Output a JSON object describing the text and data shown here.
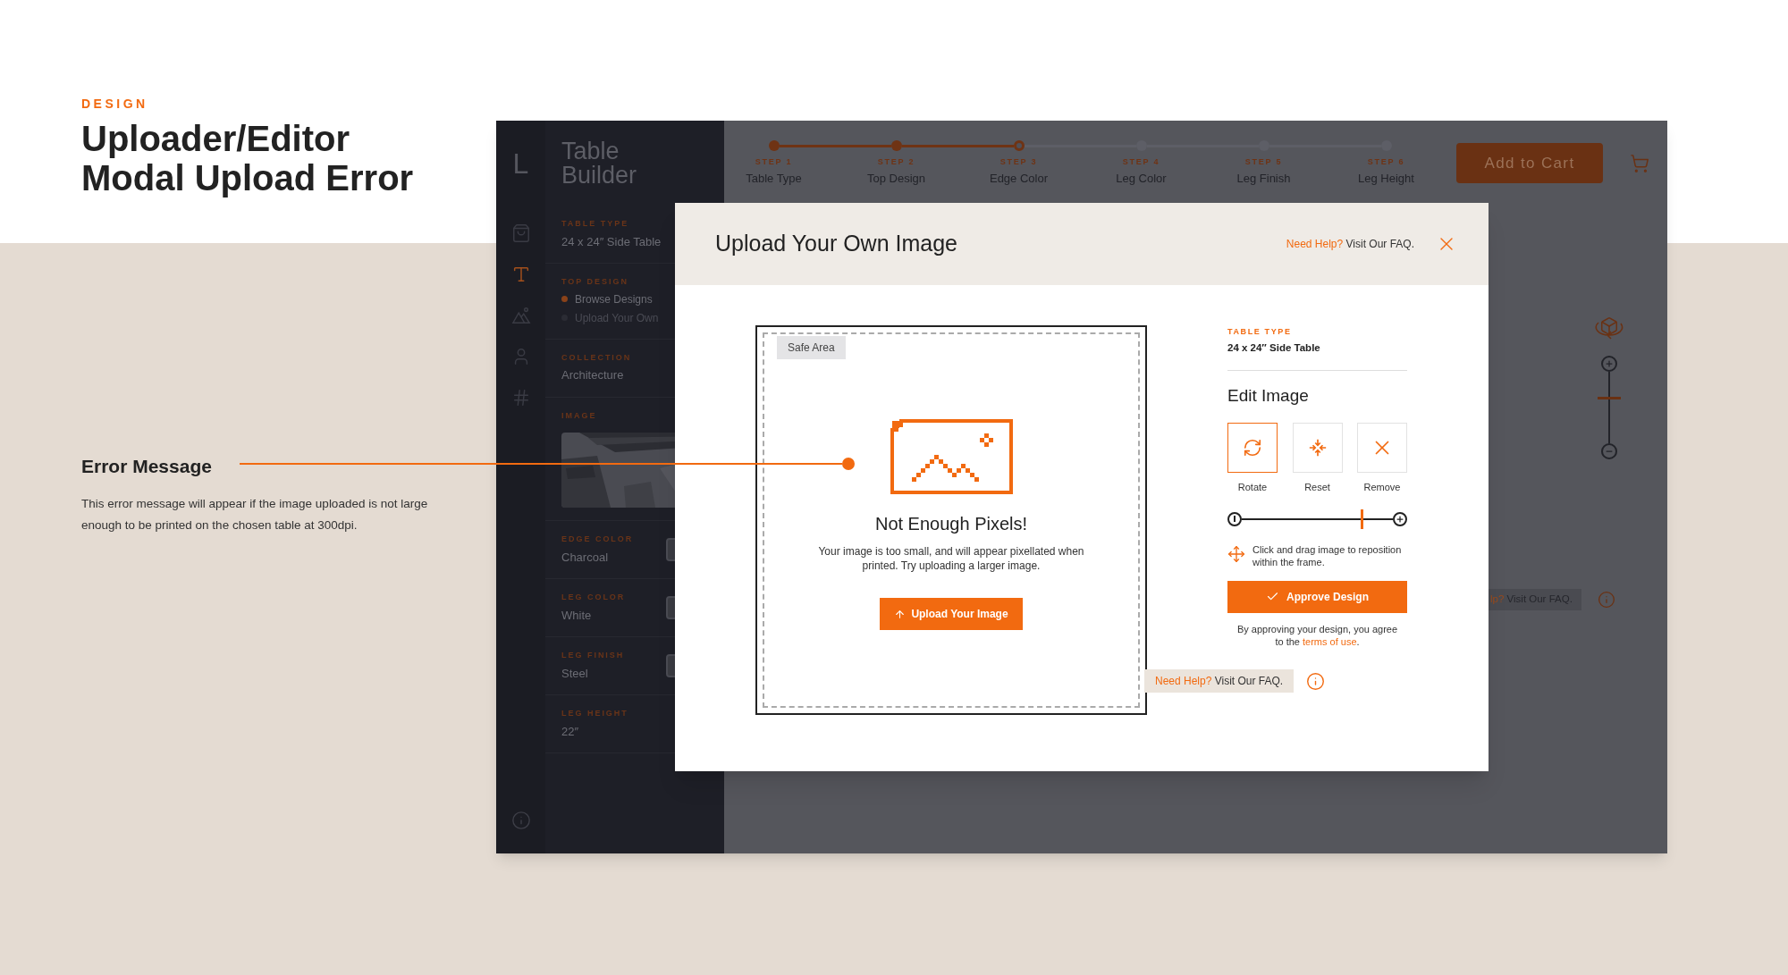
{
  "slide": {
    "eyebrow": "DESIGN",
    "title_lines": [
      "Uploader/Editor",
      "Modal Upload Error"
    ]
  },
  "annotation": {
    "title": "Error Message",
    "body": "This error message will appear if the image uploaded is not large enough to be printed on the chosen table at 300dpi."
  },
  "app": {
    "logo": "L",
    "brand_lines": [
      "Table",
      "Builder"
    ],
    "nav_icons": [
      {
        "kind": "bag",
        "selected": false
      },
      {
        "kind": "type",
        "selected": true
      },
      {
        "kind": "mountains",
        "selected": false
      },
      {
        "kind": "person",
        "selected": false
      },
      {
        "kind": "hash",
        "selected": false
      }
    ],
    "sections": [
      {
        "kind": "value",
        "label": "TABLE TYPE",
        "value": "24 x 24″ Side Table"
      },
      {
        "kind": "radio",
        "label": "TOP DESIGN",
        "options": [
          {
            "label": "Browse Designs",
            "selected": true
          },
          {
            "label": "Upload Your Own",
            "selected": false
          }
        ]
      },
      {
        "kind": "value",
        "label": "COLLECTION",
        "value": "Architecture"
      },
      {
        "kind": "picture",
        "label": "IMAGE"
      },
      {
        "kind": "swatch",
        "label": "EDGE COLOR",
        "value": "Charcoal"
      },
      {
        "kind": "swatch",
        "label": "LEG COLOR",
        "value": "White"
      },
      {
        "kind": "swatch",
        "label": "LEG FINISH",
        "value": "Steel"
      },
      {
        "kind": "value",
        "label": "LEG HEIGHT",
        "value": "22″"
      }
    ],
    "steps": [
      {
        "step": "STEP 1",
        "name": "Table Type",
        "completed": true,
        "selected": false
      },
      {
        "step": "STEP 2",
        "name": "Top Design",
        "completed": true,
        "selected": false
      },
      {
        "step": "STEP 3",
        "name": "Edge Color",
        "completed": false,
        "selected": true
      },
      {
        "step": "STEP 4",
        "name": "Leg Color",
        "completed": false,
        "selected": false
      },
      {
        "step": "STEP 5",
        "name": "Leg Finish",
        "completed": false,
        "selected": false
      },
      {
        "step": "STEP 6",
        "name": "Leg Height",
        "completed": false,
        "selected": false
      }
    ],
    "cart_button": "Add to Cart",
    "view_zoom": {
      "level": 0.65
    },
    "side_tooltip": {
      "link": "lp?",
      "text": "Visit Our FAQ."
    }
  },
  "modal": {
    "title": "Upload Your Own Image",
    "help": {
      "link": "Need Help?",
      "text": "Visit Our FAQ."
    },
    "canvas": {
      "tag": "Safe Area",
      "error_title": "Not Enough Pixels!",
      "error_body": "Your image is too small, and will appear pixellated when printed. Try uploading a larger image.",
      "upload_button": "Upload Your Image"
    },
    "panel": {
      "type_label": "TABLE TYPE",
      "type_value": "24 x 24″ Side Table",
      "heading": "Edit Image",
      "tools": [
        {
          "kind": "rotate",
          "label": "Rotate",
          "selected": true
        },
        {
          "kind": "reset",
          "label": "Reset",
          "selected": false
        },
        {
          "kind": "remove",
          "label": "Remove",
          "selected": false
        }
      ],
      "zoom": {
        "level": 0.8
      },
      "hint": "Click and drag image to reposition within the frame.",
      "approve_button": "Approve Design",
      "terms": "By approving your design, you agree to the",
      "terms_link": "terms of use",
      "terms_end": "."
    },
    "tooltip": {
      "link": "Need Help?",
      "text": "Visit Our FAQ."
    }
  }
}
